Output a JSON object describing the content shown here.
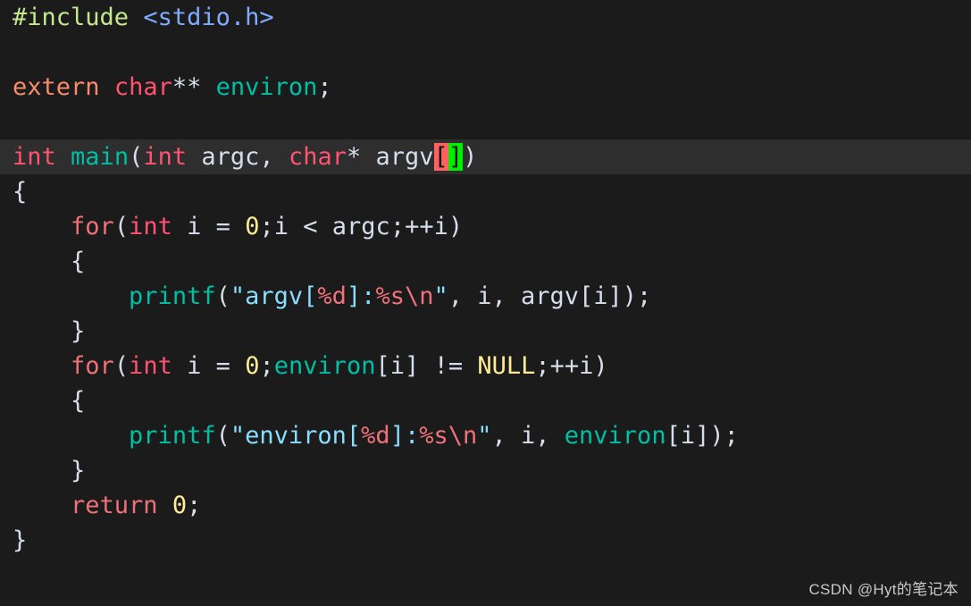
{
  "editor": {
    "background_color": "#1b1b1b",
    "highlight_line_color": "#2e2e2e",
    "default_text_color": "#d6deeb",
    "language": "c",
    "cursor": {
      "character": "]",
      "background_color": "#00ee00",
      "foreground_color": "#101010",
      "line": 4
    },
    "bracket_match": {
      "character": "[",
      "background_color": "#ff6060",
      "foreground_color": "#101010"
    },
    "active_line_number": 4
  },
  "code": {
    "line1": {
      "preproc": "#include",
      "space": " ",
      "header": "<stdio.h>"
    },
    "line2": {
      "text": ""
    },
    "line3": {
      "storage": "extern",
      "space1": " ",
      "keyword": "char",
      "stars": "**",
      "space2": " ",
      "ident": "environ",
      "semi": ";"
    },
    "line4": {
      "text": ""
    },
    "line5": {
      "int1": "int",
      "space1": " ",
      "func": "main",
      "paren_open": "(",
      "int2": "int",
      "space2": " ",
      "argc": "argc",
      "comma": ",",
      "space3": " ",
      "char": "char",
      "star": "*",
      "space4": " ",
      "argv": "argv",
      "bracket_open": "[",
      "bracket_close": "]",
      "paren_close": ")"
    },
    "line6": {
      "brace": "{"
    },
    "line7": {
      "indent": "    ",
      "for": "for",
      "paren_open": "(",
      "int": "int",
      "space1": " ",
      "i": "i",
      "space2": " ",
      "eq": "=",
      "space3": " ",
      "zero": "0",
      "semi1": ";",
      "i2": "i",
      "space4": " ",
      "lt": "<",
      "space5": " ",
      "argc": "argc",
      "semi2": ";",
      "incr": "++i",
      "paren_close": ")"
    },
    "line8": {
      "indent": "    ",
      "brace": "{"
    },
    "line9": {
      "indent": "        ",
      "func": "printf",
      "paren_open": "(",
      "quote1": "\"",
      "str1": "argv[",
      "fmt1": "%d",
      "str2": "]:",
      "fmt2": "%s",
      "esc": "\\n",
      "quote2": "\"",
      "rest": ", i, argv[i]);"
    },
    "line10": {
      "indent": "    ",
      "brace": "}"
    },
    "line11": {
      "indent": "    ",
      "for": "for",
      "paren_open": "(",
      "int": "int",
      "space1": " ",
      "i": "i",
      "space2": " ",
      "eq": "=",
      "space3": " ",
      "zero": "0",
      "semi1": ";",
      "environ": "environ",
      "index": "[i]",
      "space4": " ",
      "neq": "!=",
      "space5": " ",
      "null": "NULL",
      "semi2": ";",
      "incr": "++i",
      "paren_close": ")"
    },
    "line12": {
      "indent": "    ",
      "brace": "{"
    },
    "line13": {
      "indent": "        ",
      "func": "printf",
      "paren_open": "(",
      "quote1": "\"",
      "str1": "environ[",
      "fmt1": "%d",
      "str2": "]:",
      "fmt2": "%s",
      "esc": "\\n",
      "quote2": "\"",
      "rest1": ", i, ",
      "environ": "environ",
      "rest2": "[i]);"
    },
    "line14": {
      "indent": "    ",
      "brace": "}"
    },
    "line15": {
      "indent": "    ",
      "return": "return",
      "space": " ",
      "zero": "0",
      "semi": ";"
    },
    "line16": {
      "brace": "}"
    }
  },
  "watermark": {
    "text": "CSDN @Hyt的笔记本"
  }
}
